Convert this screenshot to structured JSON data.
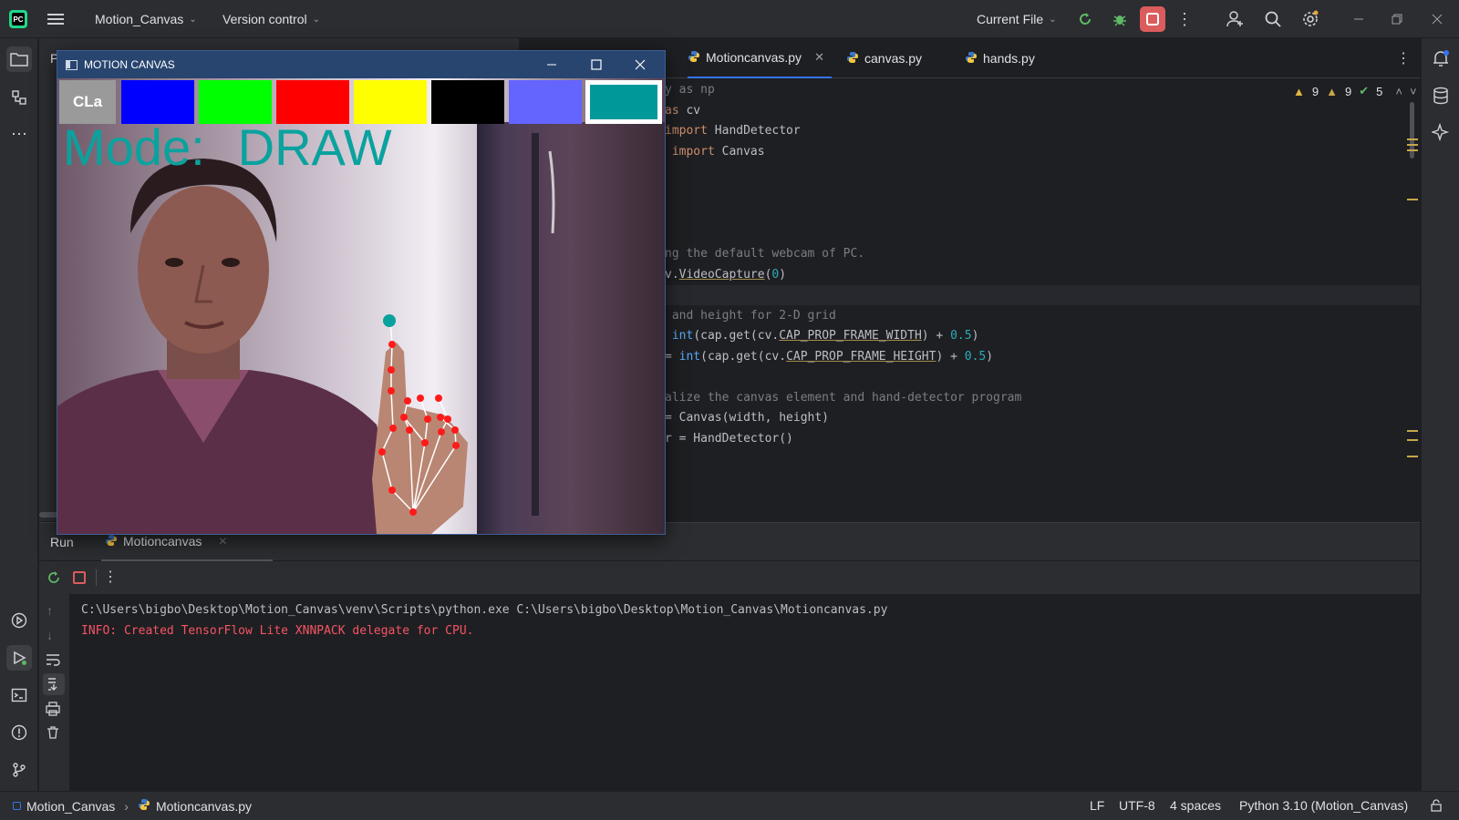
{
  "titlebar": {
    "project": "Motion_Canvas",
    "vcs": "Version control",
    "run_config": "Current File"
  },
  "editor": {
    "tabs": [
      {
        "label": "Motioncanvas.py",
        "active": true,
        "closable": true
      },
      {
        "label": "canvas.py"
      },
      {
        "label": "hands.py"
      }
    ],
    "inspections": {
      "warnings": "9",
      "weak_warnings": "9",
      "ok": "5"
    },
    "code": {
      "l1": "y as np",
      "l2a": "as",
      "l2b": " cv",
      "l3a": "import",
      "l3b": " HandDetector",
      "l4a": " import",
      "l4b": " Canvas",
      "l5": "ng the default webcam of PC.",
      "l6a": "v.",
      "l6b": "VideoCapture",
      "l6c": "(",
      "l6d": "0",
      "l6e": ")",
      "l7": " and height for 2-D grid",
      "l8a": " int",
      "l8b": "(cap.get(cv.",
      "l8c": "CAP_PROP_FRAME_WIDTH",
      "l8d": ") + ",
      "l8e": "0.5",
      "l8f": ")",
      "l9a": "= ",
      "l9b": "int",
      "l9c": "(cap.get(cv.",
      "l9d": "CAP_PROP_FRAME_HEIGHT",
      "l9e": ") + ",
      "l9f": "0.5",
      "l9g": ")",
      "l10": "alize the canvas element and hand-detector program",
      "l11": "= Canvas(width, height)",
      "l12": "r = HandDetector()"
    }
  },
  "project_panel": {
    "header_letter": "P"
  },
  "run": {
    "tab_run": "Run",
    "tab_config": "Motioncanvas",
    "console_lines": [
      {
        "text": "C:\\Users\\bigbo\\Desktop\\Motion_Canvas\\venv\\Scripts\\python.exe C:\\Users\\bigbo\\Desktop\\Motion_Canvas\\Motioncanvas.py",
        "color": "#bcbec4"
      },
      {
        "text": "INFO: Created TensorFlow Lite XNNPACK delegate for CPU.",
        "color": "#f75464"
      }
    ]
  },
  "statusbar": {
    "breadcrumb_project": "Motion_Canvas",
    "breadcrumb_file": "Motioncanvas.py",
    "line_sep": "LF",
    "encoding": "UTF-8",
    "indent": "4 spaces",
    "interpreter": "Python 3.10 (Motion_Canvas)"
  },
  "cv_window": {
    "title": "MOTION CANVAS",
    "clear_label": "CLa",
    "mode_label": "Mode:",
    "mode_value": "DRAW",
    "swatches": [
      "#0000ff",
      "#00ff00",
      "#ff0000",
      "#ffff00",
      "#000000",
      "#6464ff",
      "#009999"
    ],
    "selected_swatch": "#009999",
    "overlay_color": "#0aa29e"
  },
  "colors": {
    "accent": "#3574f0",
    "ide_bg": "#1e1f22",
    "panel_bg": "#2b2d30",
    "warning": "#e2b53f",
    "ok": "#5fb865",
    "stop": "#db5c5c"
  }
}
